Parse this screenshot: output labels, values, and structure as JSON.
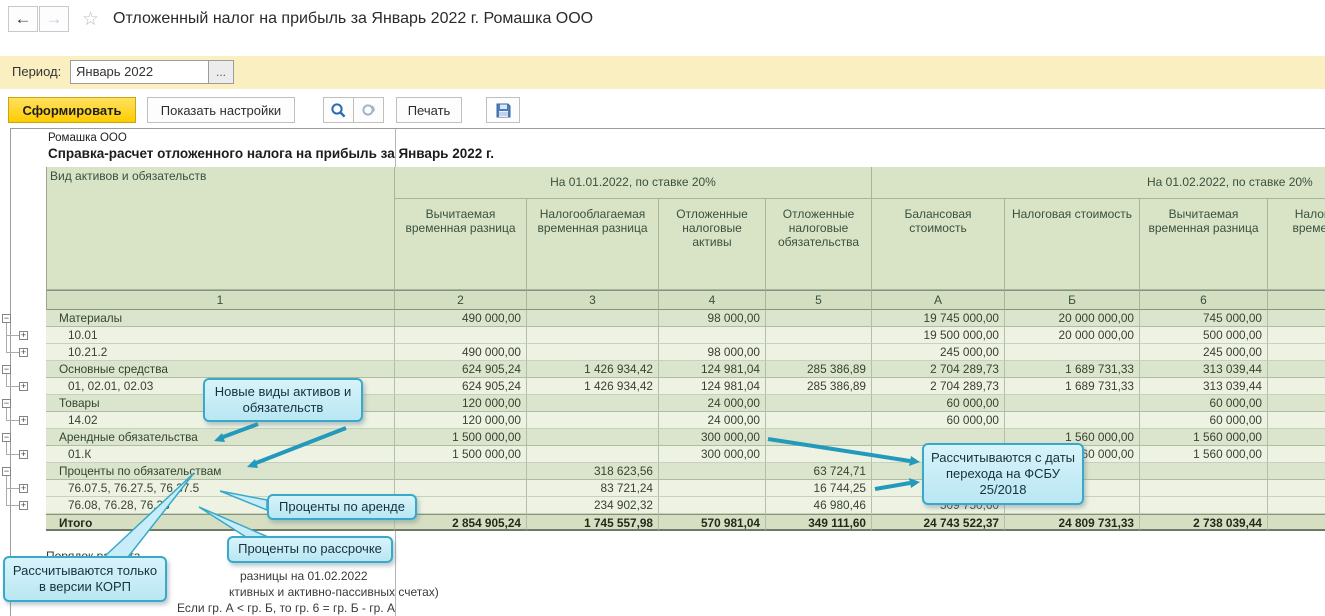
{
  "window": {
    "title": "Отложенный налог на прибыль за Январь 2022 г. Ромашка ООО"
  },
  "period": {
    "label": "Период:",
    "value": "Январь 2022",
    "picker_label": "..."
  },
  "actions": {
    "generate": "Сформировать",
    "show_settings": "Показать настройки",
    "print": "Печать",
    "search_icon": "magnifier",
    "repeat_search_icon": "magnifier-refresh",
    "save_icon": "floppy-disk"
  },
  "report": {
    "company": "Ромашка ООО",
    "title": "Справка-расчет отложенного налога на прибыль за Январь 2022 г.",
    "header": {
      "entity_label": "Вид активов и обязательств",
      "entity_code": "1",
      "group1": "На 01.01.2022, по ставке 20%",
      "group2": "На 01.02.2022, по ставке 20%",
      "columns": [
        {
          "code": "2",
          "label": "Вычитаемая временная разница"
        },
        {
          "code": "3",
          "label": "Налогооблагаемая временная разница"
        },
        {
          "code": "4",
          "label": "Отложенные налоговые активы"
        },
        {
          "code": "5",
          "label": "Отложенные налоговые обязательства"
        },
        {
          "code": "А",
          "label": "Балансовая стоимость"
        },
        {
          "code": "Б",
          "label": "Налоговая стоимость"
        },
        {
          "code": "6",
          "label": "Вычитаемая временная разница"
        },
        {
          "code": "",
          "label": "Налогооблагаемая временная разница"
        }
      ]
    },
    "rows": [
      {
        "label": "Материалы",
        "level": 1,
        "expander": "minus",
        "type": "group",
        "cells": [
          "490 000,00",
          "",
          "98 000,00",
          "",
          "19 745 000,00",
          "20 000 000,00",
          "745 000,00",
          ""
        ]
      },
      {
        "label": "10.01",
        "level": 2,
        "expander": "plus",
        "type": "detail",
        "cells": [
          "",
          "",
          "",
          "",
          "19 500 000,00",
          "20 000 000,00",
          "500 000,00",
          ""
        ]
      },
      {
        "label": "10.21.2",
        "level": 2,
        "expander": "plus",
        "type": "detail",
        "cells": [
          "490 000,00",
          "",
          "98 000,00",
          "",
          "245 000,00",
          "",
          "245 000,00",
          ""
        ]
      },
      {
        "label": "Основные средства",
        "level": 1,
        "expander": "minus",
        "type": "group",
        "cells": [
          "624 905,24",
          "1 426 934,42",
          "124 981,04",
          "285 386,89",
          "2 704 289,73",
          "1 689 731,33",
          "313 039,44",
          ""
        ]
      },
      {
        "label": "01, 02.01, 02.03",
        "level": 2,
        "expander": "plus",
        "type": "detail",
        "cells": [
          "624 905,24",
          "1 426 934,42",
          "124 981,04",
          "285 386,89",
          "2 704 289,73",
          "1 689 731,33",
          "313 039,44",
          ""
        ]
      },
      {
        "label": "Товары",
        "level": 1,
        "expander": "minus",
        "type": "group",
        "cells": [
          "120 000,00",
          "",
          "24 000,00",
          "",
          "60 000,00",
          "",
          "60 000,00",
          ""
        ]
      },
      {
        "label": "14.02",
        "level": 2,
        "expander": "plus",
        "type": "detail",
        "cells": [
          "120 000,00",
          "",
          "24 000,00",
          "",
          "60 000,00",
          "",
          "60 000,00",
          ""
        ]
      },
      {
        "label": "Арендные обязательства",
        "level": 1,
        "expander": "minus",
        "type": "group",
        "cells": [
          "1 500 000,00",
          "",
          "300 000,00",
          "",
          "",
          "1 560 000,00",
          "1 560 000,00",
          ""
        ]
      },
      {
        "label": "01.К",
        "level": 2,
        "expander": "plus",
        "type": "detail",
        "cells": [
          "1 500 000,00",
          "",
          "300 000,00",
          "",
          "",
          "1 560 000,00",
          "1 560 000,00",
          ""
        ]
      },
      {
        "label": "Проценты по обязательствам",
        "level": 1,
        "expander": "minus",
        "type": "group",
        "cells": [
          "",
          "318 623,56",
          "",
          "63 724,71",
          "",
          "",
          "",
          ""
        ]
      },
      {
        "label": "76.07.5, 76.27.5, 76.37.5",
        "level": 2,
        "expander": "plus",
        "type": "detail",
        "cells": [
          "",
          "83 721,24",
          "",
          "16 744,25",
          "",
          "",
          "",
          ""
        ]
      },
      {
        "label": "76.08, 76.28, 76.38",
        "level": 2,
        "expander": "plus",
        "type": "detail",
        "cells": [
          "",
          "234 902,32",
          "",
          "46 980,46",
          "509 750,60",
          "",
          "",
          ""
        ]
      },
      {
        "label": "Итого",
        "level": 0,
        "expander": null,
        "type": "total",
        "cells": [
          "2 854 905,24",
          "1 745 557,98",
          "570 981,04",
          "349 111,60",
          "24 743 522,37",
          "24 809 731,33",
          "2 738 039,44",
          ""
        ]
      }
    ],
    "footer": {
      "heading": "Порядок расчета",
      "fragments": [
        "разницы на 01.02.2022",
        "ктивных и активно-пассивных счетах)",
        "Если гр. А < гр. Б, то гр. 6 = гр. Б - гр. А"
      ]
    }
  },
  "annotations": {
    "new_types": "Новые виды активов и обязательств",
    "lease_interest": "Проценты по аренде",
    "installment_interest": "Проценты по рассрочке",
    "korp_only": "Рассчитываются только в версии КОРП",
    "fsbu": "Рассчитываются с даты перехода на ФСБУ 25/2018"
  },
  "colors": {
    "annotation_border": "#38a9c9",
    "annotation_fill": "#c9edf8",
    "arrow_teal": "#2399bc",
    "generate_button": "#ffd21e",
    "period_bar": "#faefc0",
    "header_green": "#d9e4c7",
    "group_row_green": "#dbe5cd",
    "detail_row_green": "#edf2e3",
    "total_row_green": "#d6dfc2",
    "search_icon_blue": "#2b6cb5",
    "save_icon_blue": "#4a7ebb"
  }
}
